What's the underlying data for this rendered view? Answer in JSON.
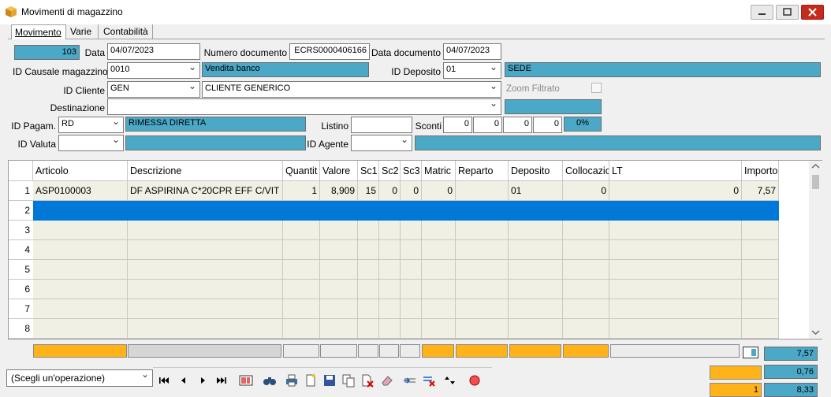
{
  "window": {
    "title": "Movimenti di magazzino",
    "icon": "box-icon"
  },
  "tabs": [
    {
      "label": "Movimento"
    },
    {
      "label": "Varie"
    },
    {
      "label": "Contabilità"
    }
  ],
  "form": {
    "id": "103",
    "data_label": "Data",
    "data_value": "04/07/2023",
    "numero_label": "Numero documento",
    "numero_value": "ECRS0000406166",
    "data_doc_label": "Data documento",
    "data_doc_value": "04/07/2023",
    "causale_label": "ID Causale magazzino",
    "causale_value": "0010",
    "causale_desc": "Vendita banco",
    "deposito_label": "ID Deposito",
    "deposito_value": "01",
    "deposito_desc": "SEDE",
    "cliente_label": "ID Cliente",
    "cliente_value": "GEN",
    "cliente_desc": "CLIENTE GENERICO",
    "zoom_label": "Zoom Filtrato",
    "destinazione_label": "Destinazione",
    "destinazione_value": "",
    "pagam_label": "ID Pagam.",
    "pagam_value": "RD",
    "pagam_desc": "RIMESSA DIRETTA",
    "listino_label": "Listino",
    "listino_value": "",
    "sconti_label": "Sconti",
    "sconti": [
      "0",
      "0",
      "0",
      "0"
    ],
    "sconti_pct": "0%",
    "valuta_label": "ID Valuta",
    "valuta_value": "",
    "agente_label": "ID Agente",
    "agente_value": ""
  },
  "grid": {
    "columns": [
      "Articolo",
      "Descrizione",
      "Quantit",
      "Valore",
      "Sc1",
      "Sc2",
      "Sc3",
      "Matric",
      "Reparto",
      "Deposito",
      "Collocazio",
      "LT",
      "Importo"
    ],
    "rows": [
      {
        "num": "1",
        "articolo": "ASP0100003",
        "descrizione": "DF ASPIRINA C*20CPR EFF C/VIT C",
        "quantita": "1",
        "valore": "8,909",
        "sc1": "15",
        "sc2": "0",
        "sc3": "0",
        "matric": "0",
        "reparto": "",
        "deposito": "01",
        "collocazione": "0",
        "lt": "0",
        "importo": "7,57"
      },
      {
        "num": "2"
      },
      {
        "num": "3"
      },
      {
        "num": "4"
      },
      {
        "num": "5"
      },
      {
        "num": "6"
      },
      {
        "num": "7"
      },
      {
        "num": "8"
      }
    ]
  },
  "totals": {
    "importo": "7,57",
    "val2": "0,76",
    "count": "1",
    "val3": "8,33"
  },
  "toolbar": {
    "operation_select": "(Scegli un'operazione)"
  }
}
